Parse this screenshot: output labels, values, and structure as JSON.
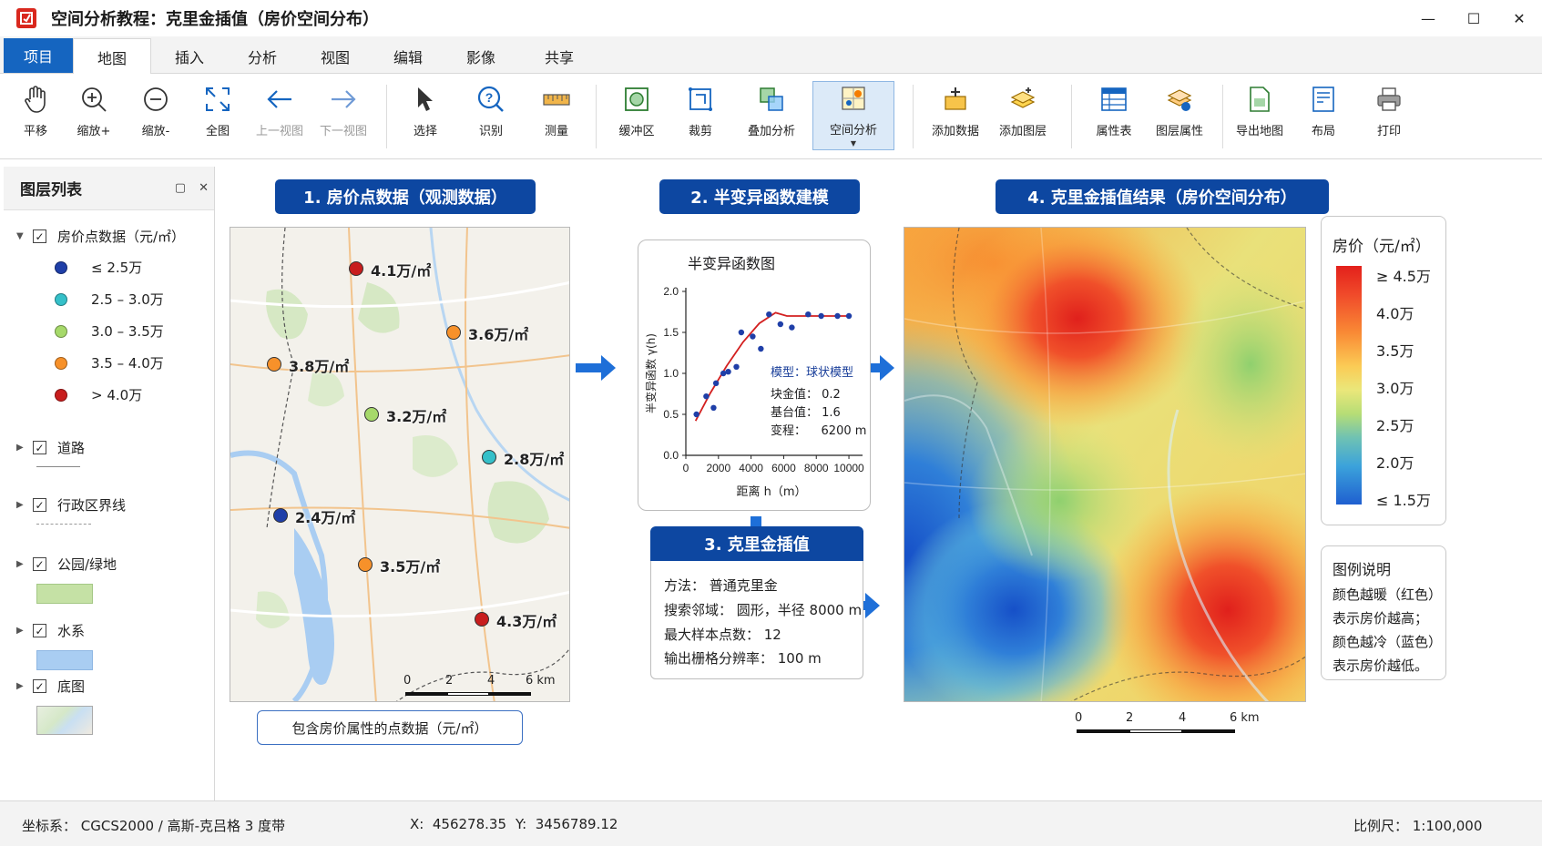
{
  "window": {
    "title": "空间分析教程：克里金插值（房价空间分布）",
    "minimize": "—",
    "maximize": "☐",
    "close": "✕"
  },
  "tabs": [
    "项目",
    "地图",
    "插入",
    "分析",
    "视图",
    "编辑",
    "影像",
    "共享"
  ],
  "toolbar": {
    "pan": "平移",
    "zoom_in": "缩放+",
    "zoom_out": "缩放-",
    "full_extent": "全图",
    "prev_view": "上一视图",
    "next_view": "下一视图",
    "select": "选择",
    "identify": "识别",
    "measure": "测量",
    "buffer": "缓冲区",
    "clip": "裁剪",
    "overlay": "叠加分析",
    "spatial_analysis": "空间分析",
    "add_data": "添加数据",
    "add_layer": "添加图层",
    "attribute_table": "属性表",
    "layer_properties": "图层属性",
    "export_map": "导出地图",
    "layout": "布局",
    "print": "打印"
  },
  "layers_panel": {
    "title": "图层列表",
    "point_layer": "房价点数据（元/㎡）",
    "classes": [
      {
        "label": "≤ 2.5万",
        "color": "#1f3fa8"
      },
      {
        "label": "2.5 – 3.0万",
        "color": "#35c0c9"
      },
      {
        "label": "3.0 – 3.5万",
        "color": "#a6d96a"
      },
      {
        "label": "3.5 – 4.0万",
        "color": "#f7912a"
      },
      {
        "label": "> 4.0万",
        "color": "#c81d1d"
      }
    ],
    "roads": "道路",
    "admin": "行政区界线",
    "parks": "公园/绿地",
    "water": "水系",
    "basemap": "底图",
    "check": "✓"
  },
  "steps": {
    "step1": "1. 房价点数据（观测数据）",
    "step2": "2. 半变异函数建模",
    "step3": "3. 克里金插值",
    "step4": "4. 克里金插值结果（房价空间分布）"
  },
  "points": [
    {
      "label": "4.1万/㎡",
      "cls": 4
    },
    {
      "label": "3.6万/㎡",
      "cls": 3
    },
    {
      "label": "3.8万/㎡",
      "cls": 3
    },
    {
      "label": "3.2万/㎡",
      "cls": 2
    },
    {
      "label": "2.8万/㎡",
      "cls": 1
    },
    {
      "label": "2.4万/㎡",
      "cls": 0
    },
    {
      "label": "3.5万/㎡",
      "cls": 3
    },
    {
      "label": "4.3万/㎡",
      "cls": 4
    }
  ],
  "caption_points": "包含房价属性的点数据（元/㎡）",
  "scale_labels": [
    "0",
    "2",
    "4",
    "6 km"
  ],
  "semivariogram": {
    "title": "半变异函数图",
    "model_label": "模型：球状模型",
    "nugget": "块金值：  0.2",
    "sill": "基台值：  1.6",
    "range": "变程：    6200 m"
  },
  "chart_data": {
    "type": "scatter",
    "title": "半变异函数图",
    "xlabel": "距离 h（m）",
    "ylabel": "半变异函数 γ(h)",
    "xlim": [
      0,
      10500
    ],
    "ylim": [
      0,
      2.0
    ],
    "xticks": [
      0,
      2000,
      4000,
      6000,
      8000,
      10000
    ],
    "yticks": [
      0.0,
      0.5,
      1.0,
      1.5,
      2.0
    ],
    "ytick_labels": [
      "0.0",
      "0.5",
      "1.0",
      "1.5",
      "2.0"
    ],
    "series": [
      {
        "name": "",
        "type": "scatter",
        "x": [
          650,
          1250,
          1700,
          1850,
          2300,
          2600,
          3100,
          3400,
          4100,
          4600,
          5100,
          5800,
          6500,
          7500,
          8300,
          9300,
          10000
        ],
        "y": [
          0.5,
          0.72,
          0.58,
          0.88,
          1.0,
          1.02,
          1.08,
          1.5,
          1.45,
          1.3,
          1.72,
          1.6,
          1.56,
          1.72,
          1.7,
          1.7,
          1.7
        ]
      },
      {
        "name": "",
        "type": "line",
        "model": "spherical",
        "nugget": 0.2,
        "sill": 1.6,
        "range": 6200,
        "x": [
          600,
          1500,
          2500,
          3500,
          4500,
          5500,
          6200,
          8000,
          10000
        ],
        "y": [
          0.42,
          0.76,
          1.09,
          1.38,
          1.61,
          1.74,
          1.7,
          1.7,
          1.7
        ]
      }
    ]
  },
  "kriging": {
    "method": "方法：  普通克里金",
    "neighborhood": "搜索邻域：  圆形，半径 8000 m",
    "max_points": "最大样本点数：  12",
    "resolution": "输出栅格分辨率：  100 m"
  },
  "legend": {
    "title": "房价（元/㎡）",
    "ticks": [
      "≥ 4.5万",
      "4.0万",
      "3.5万",
      "3.0万",
      "2.5万",
      "2.0万",
      "≤ 1.5万"
    ],
    "note_title": "图例说明",
    "notes": [
      "颜色越暖（红色）",
      "表示房价越高；",
      "颜色越冷（蓝色）",
      "表示房价越低。"
    ]
  },
  "status": {
    "crs": "坐标系：  CGCS2000 / 高斯-克吕格 3 度带",
    "x": "X:  456278.35",
    "y": "Y:  3456789.12",
    "scale": "比例尺：  1:100,000"
  }
}
